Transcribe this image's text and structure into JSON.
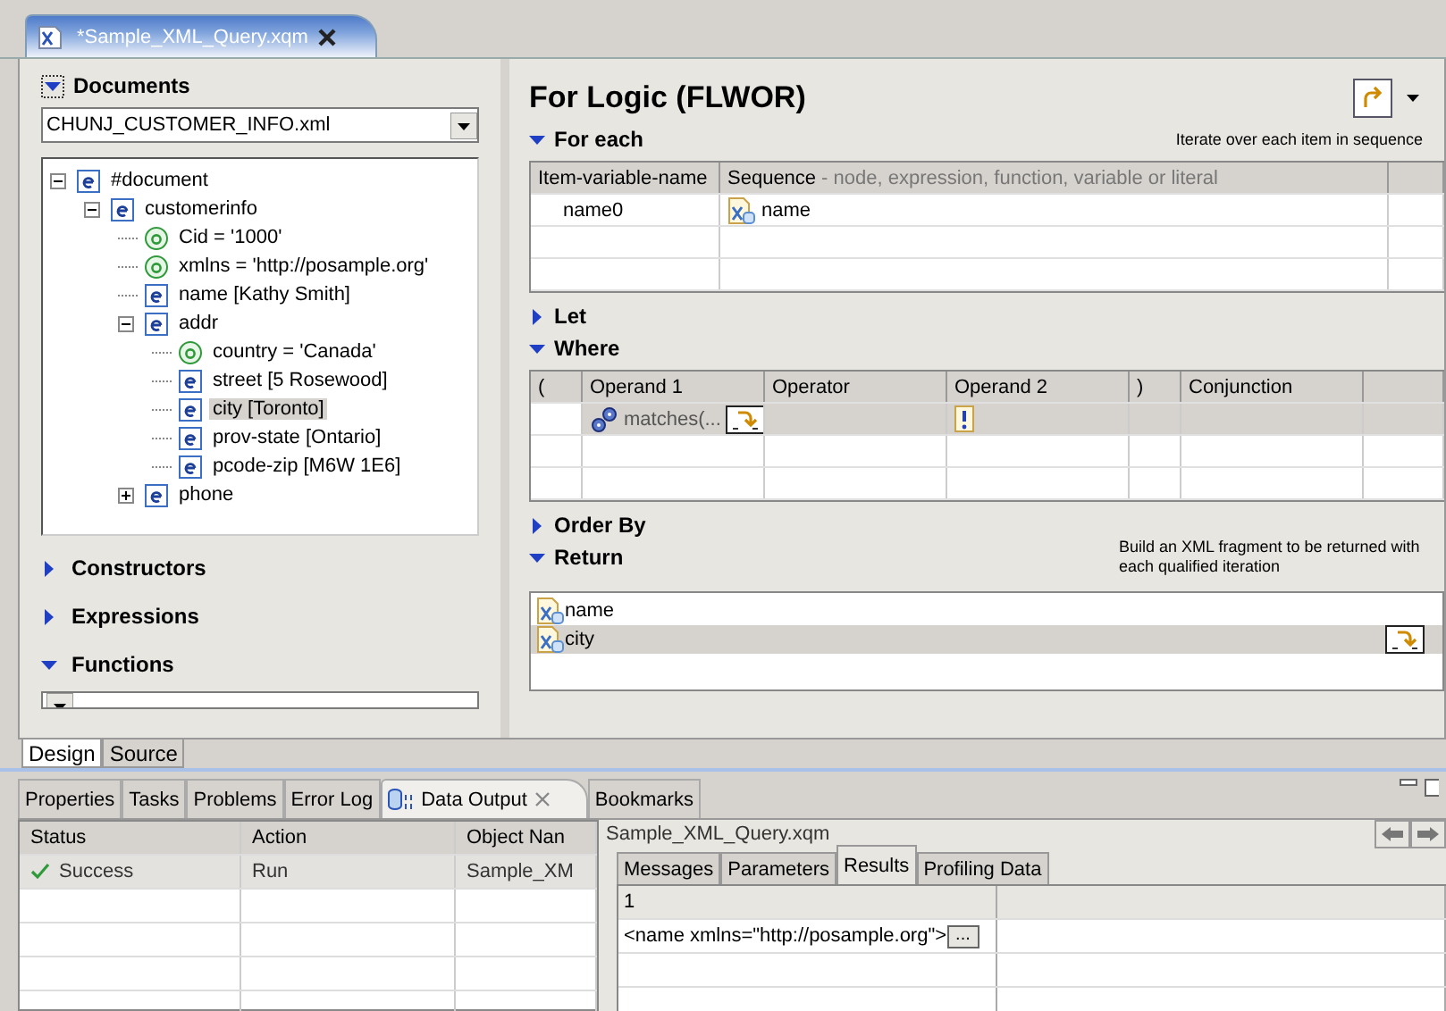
{
  "editor_tab": {
    "title": "*Sample_XML_Query.xqm",
    "selected": true
  },
  "documents": {
    "title": "Documents",
    "expanded": true,
    "file": "CHUNJ_CUSTOMER_INFO.xml",
    "tree": [
      {
        "kind": "element",
        "label": "#document",
        "expanded": true,
        "selected": false,
        "children": [
          {
            "kind": "element",
            "label": "customerinfo",
            "expanded": true,
            "selected": false,
            "children": [
              {
                "kind": "attribute",
                "label": "Cid = '1000'",
                "selected": false
              },
              {
                "kind": "attribute",
                "label": "xmlns = 'http://posample.org'",
                "selected": false
              },
              {
                "kind": "element",
                "label": "name  [Kathy Smith]",
                "selected": false
              },
              {
                "kind": "element",
                "label": "addr",
                "expanded": true,
                "selected": false,
                "children": [
                  {
                    "kind": "attribute",
                    "label": "country = 'Canada'",
                    "selected": false
                  },
                  {
                    "kind": "element",
                    "label": "street  [5 Rosewood]",
                    "selected": false
                  },
                  {
                    "kind": "element",
                    "label": "city  [Toronto]",
                    "selected": true
                  },
                  {
                    "kind": "element",
                    "label": "prov-state  [Ontario]",
                    "selected": false
                  },
                  {
                    "kind": "element",
                    "label": "pcode-zip  [M6W 1E6]",
                    "selected": false
                  }
                ]
              },
              {
                "kind": "element",
                "label": "phone",
                "expanded": false,
                "selected": false
              }
            ]
          }
        ]
      }
    ]
  },
  "palette_sections": [
    {
      "title": "Constructors",
      "expanded": false
    },
    {
      "title": "Expressions",
      "expanded": false
    },
    {
      "title": "Functions",
      "expanded": true
    }
  ],
  "page_tabs": [
    {
      "label": "Design",
      "selected": true
    },
    {
      "label": "Source",
      "selected": false
    }
  ],
  "flwor": {
    "title": "For Logic (FLWOR)",
    "for_each": {
      "title": "For each",
      "expanded": true,
      "hint": "Iterate over each item in sequence",
      "columns": [
        {
          "label": "Item-variable-name"
        },
        {
          "label": "Sequence",
          "note": "- node, expression, function, variable or literal"
        }
      ],
      "rows": [
        {
          "variable": "name0",
          "sequence": "name"
        }
      ]
    },
    "let": {
      "title": "Let",
      "expanded": false
    },
    "where": {
      "title": "Where",
      "expanded": true,
      "columns": [
        "(",
        "Operand 1",
        "Operator",
        "Operand 2",
        ")",
        "Conjunction"
      ],
      "rows": [
        {
          "operand_1": "matches(...",
          "selected": true
        }
      ]
    },
    "order_by": {
      "title": "Order By",
      "expanded": false
    },
    "return": {
      "title": "Return",
      "expanded": true,
      "hint": "Build an XML  fragment to be returned with each qualified iteration",
      "items": [
        {
          "label": "name",
          "selected": false
        },
        {
          "label": "city",
          "selected": true
        }
      ]
    }
  },
  "view_tabs": [
    {
      "label": "Properties",
      "selected": false
    },
    {
      "label": "Tasks",
      "selected": false
    },
    {
      "label": "Problems",
      "selected": false
    },
    {
      "label": "Error Log",
      "selected": false
    },
    {
      "label": "Data Output",
      "selected": true
    },
    {
      "label": "Bookmarks",
      "selected": false
    }
  ],
  "status_table": {
    "columns": [
      "Status",
      "Action",
      "Object Nan"
    ],
    "rows": [
      {
        "status": "Success",
        "action": "Run",
        "object": "Sample_XM",
        "selected": true
      }
    ]
  },
  "result_panel": {
    "title": "Sample_XML_Query.xqm",
    "tabs": [
      {
        "label": "Messages",
        "selected": false
      },
      {
        "label": "Parameters",
        "selected": false
      },
      {
        "label": "Results",
        "selected": true
      },
      {
        "label": "Profiling Data",
        "selected": false
      }
    ],
    "columns": [
      "1"
    ],
    "rows": [
      {
        "value": "<name xmlns=\"http://posample.org\">",
        "more": "..."
      }
    ]
  }
}
